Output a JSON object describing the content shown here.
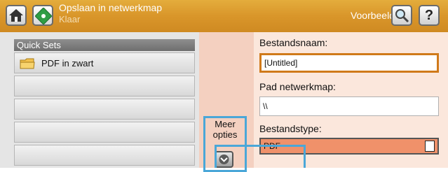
{
  "header": {
    "title": "Opslaan in netwerkmap",
    "status": "Klaar",
    "preview_label": "Voorbeeld",
    "help_glyph": "?"
  },
  "quick_sets": {
    "header": "Quick Sets",
    "items": [
      "PDF in zwart",
      "",
      "",
      "",
      ""
    ]
  },
  "more_options": {
    "label_line1": "Meer",
    "label_line2": "opties"
  },
  "form": {
    "filename_label": "Bestandsnaam:",
    "filename_value": "[Untitled]",
    "path_label": "Pad netwerkmap:",
    "path_value": "\\\\",
    "filetype_label": "Bestandstype:",
    "filetype_value": "PDF"
  },
  "colors": {
    "topbar": "#d9962a",
    "accent_border": "#d07a1a",
    "select_fill": "#f0916a",
    "highlight": "#4aa7d8"
  }
}
